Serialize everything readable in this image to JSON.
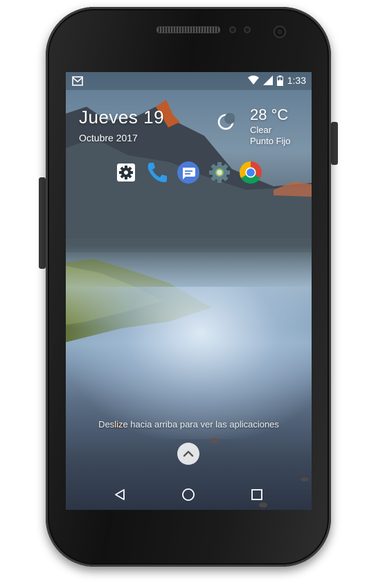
{
  "status_bar": {
    "time": "1:33",
    "icons": [
      "gmail-notification-icon",
      "wifi-icon",
      "cell-signal-icon",
      "battery-charging-icon"
    ]
  },
  "widget": {
    "day": "Jueves 19",
    "month_year": "Octubre 2017",
    "weather_icon": "moon-icon",
    "temperature": "28 °C",
    "condition": "Clear",
    "location": "Punto Fijo"
  },
  "dock": {
    "apps": [
      "settings-app-icon",
      "phone-app-icon",
      "messages-app-icon",
      "system-settings-app-icon",
      "chrome-app-icon"
    ]
  },
  "hint": {
    "text": "Deslize hacia arriba para ver las aplicaciones"
  },
  "navigation": {
    "buttons": [
      "back-icon",
      "home-icon",
      "recents-icon"
    ]
  },
  "colors": {
    "phone_accent": "#2e9be8",
    "chrome_red": "#db4437",
    "chrome_yellow": "#f4b400",
    "chrome_green": "#0f9d58",
    "chrome_blue": "#4285f4",
    "messages_blue": "#4a7bd8"
  }
}
